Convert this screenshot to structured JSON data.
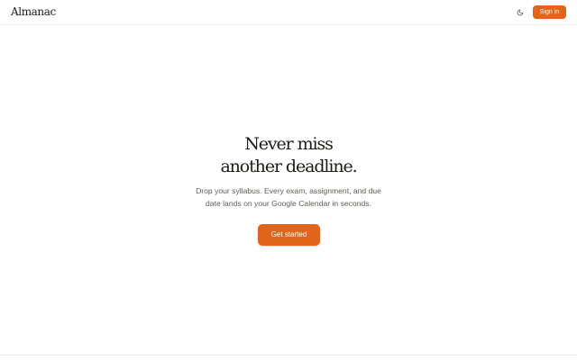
{
  "header": {
    "brand": "Almanac",
    "theme_toggle_icon": "moon-icon",
    "signin_label": "Sign in"
  },
  "hero": {
    "title_line1": "Never miss",
    "title_line2": "another deadline.",
    "subtitle_line1": "Drop your syllabus. Every exam, assignment, and due",
    "subtitle_line2": "date lands on your Google Calendar in seconds.",
    "cta_label": "Get started"
  },
  "colors": {
    "accent": "#e0651a",
    "text": "#1f1b17",
    "muted_text": "#625b55",
    "divider": "#eeeae5",
    "background": "#ffffff"
  }
}
